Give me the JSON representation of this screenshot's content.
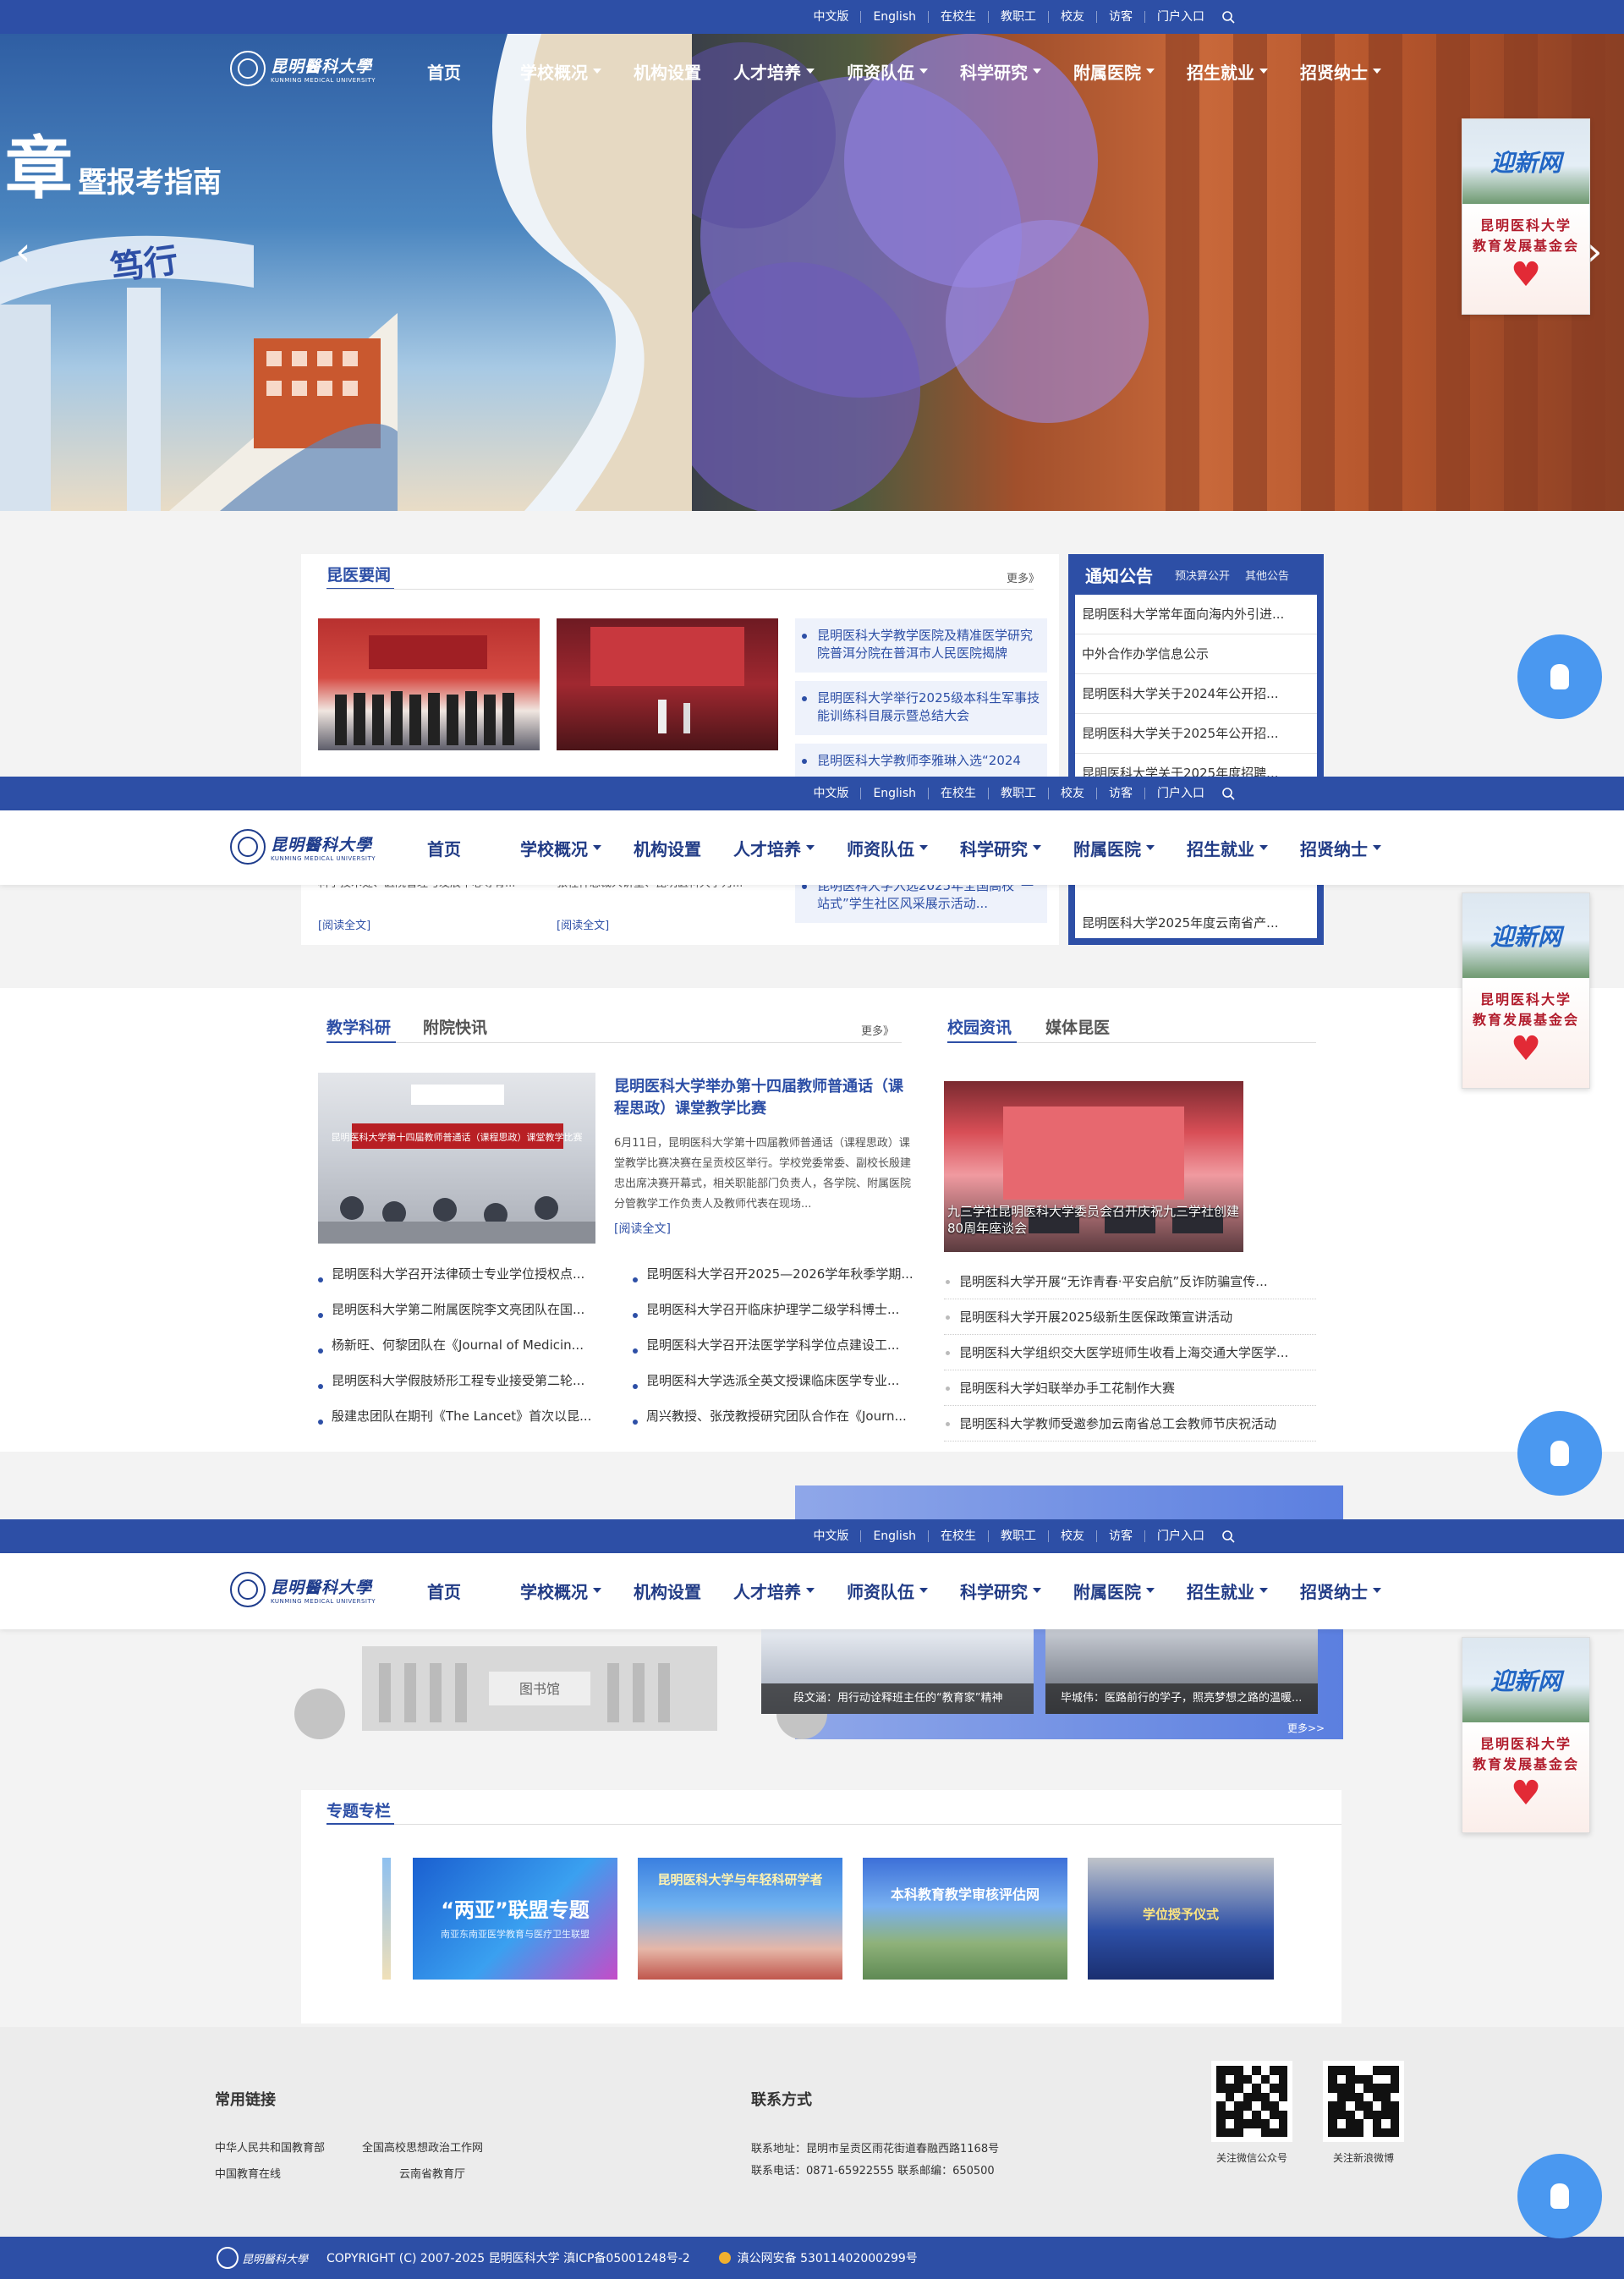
{
  "utility": {
    "items": [
      "中文版",
      "English",
      "在校生",
      "教职工",
      "校友",
      "访客",
      "门户入口"
    ]
  },
  "logo": {
    "cn": "昆明醫科大學",
    "en": "KUNMING MEDICAL UNIVERSITY"
  },
  "nav": {
    "items": [
      "首页",
      "学校概况",
      "机构设置",
      "人才培养",
      "师资队伍",
      "科学研究",
      "附属医院",
      "招生就业",
      "招贤纳士"
    ]
  },
  "hero": {
    "title_big": "章",
    "title_rest": "暨报考指南",
    "gate_text": "笃行"
  },
  "side_widget": {
    "top": "迎新网",
    "bottom_line1": "昆明医科大学",
    "bottom_line2": "教育发展基金会"
  },
  "news": {
    "title": "昆医要闻",
    "more": "更多》",
    "read_more": "[阅读全文]",
    "card1_excerpt": "科学技术处、医院管理与发展中心等有...",
    "card2_excerpt": "张程祥总裁人讲堂、昆明医科大学为...",
    "list": [
      "昆明医科大学教学医院及精准医学研究院普洱分院在普洱市人民医院揭牌",
      "昆明医科大学举行2025级本科生军事技能训练科目展示暨总结大会",
      "昆明医科大学教师李雅琳入选“2024",
      "昆明医科大学入选2025年全国高校“一站式”学生社区风采展示活动..."
    ]
  },
  "notice": {
    "title": "通知公告",
    "tab2": "预决算公开",
    "tab3": "其他公告",
    "items": [
      "昆明医科大学常年面向海内外引进...",
      "中外合作办学信息公示",
      "昆明医科大学关于2024年公开招...",
      "昆明医科大学关于2025年公开招...",
      "昆明医科大学关于2025年度招聘...",
      "昆明医科大学2025年度云南省产..."
    ]
  },
  "teaching": {
    "tab1": "教学科研",
    "tab2": "附院快讯",
    "more": "更多》",
    "feature_title": "昆明医科大学举办第十四届教师普通话（课程思政）课堂教学比赛",
    "feature_excerpt": "6月11日，昆明医科大学第十四届教师普通话（课程思政）课堂教学比赛决赛在呈贡校区举行。学校党委常委、副校长殷建忠出席决赛开幕式，相关职能部门负责人，各学院、附属医院分管教学工作负责人及教师代表在现场...",
    "read_more": "[阅读全文]",
    "img_caption": "昆明医科大学第十四届教师普通话（课程思政）课堂教学比赛",
    "left_list": [
      "昆明医科大学召开法律硕士专业学位授权点...",
      "昆明医科大学第二附属医院李文亮团队在国...",
      "杨新旺、何黎团队在《Journal of Medicin...",
      "昆明医科大学假肢矫形工程专业接受第二轮...",
      "殷建忠团队在期刊《The Lancet》首次以昆..."
    ],
    "right_list": [
      "昆明医科大学召开2025—2026学年秋季学期...",
      "昆明医科大学召开临床护理学二级学科博士...",
      "昆明医科大学召开法医学学科学位点建设工...",
      "昆明医科大学选派全英文授课临床医学专业...",
      "周兴教授、张茂教授研究团队合作在《Journ..."
    ]
  },
  "campus": {
    "tab1": "校园资讯",
    "tab2": "媒体昆医",
    "img_caption": "九三学社昆明医科大学委员会召开庆祝九三学社创建80周年座谈会",
    "list": [
      "昆明医科大学开展“无诈青春·平安启航”反诈防骗宣传...",
      "昆明医科大学开展2025级新生医保政策宣讲活动",
      "昆明医科大学组织交大医学班师生收看上海交通大学医学...",
      "昆明医科大学妇联举办手工花制作大赛",
      "昆明医科大学教师受邀参加云南省总工会教师节庆祝活动"
    ]
  },
  "people": {
    "cap1": "段文涵：用行动诠释班主任的“教育家”精神",
    "cap2": "毕城伟：医路前行的学子，照亮梦想之路的温暖...",
    "more": "更多>>",
    "library_text": "图书馆"
  },
  "topics": {
    "title": "专题专栏",
    "t1_main": "“两亚”联盟专题",
    "t1_sub": "南亚东南亚医学教育与医疗卫生联盟",
    "t2": "昆明医科大学与年轻科研学者",
    "t3": "本科教育教学审核评估网",
    "t4": "学位授予仪式"
  },
  "footer": {
    "links_title": "常用链接",
    "links": [
      "中华人民共和国教育部",
      "全国高校思想政治工作网",
      "中国教育在线",
      "云南省教育厅"
    ],
    "contact_title": "联系方式",
    "address": "联系地址：昆明市呈贡区雨花街道春融西路1168号",
    "phone": "联系电话：0871-65922555  联系邮编：650500",
    "qr1": "关注微信公众号",
    "qr2": "关注新浪微博",
    "copyright": "COPYRIGHT (C) 2007-2025  昆明医科大学  滇ICP备05001248号-2",
    "police": "滇公网安备 53011402000299号"
  },
  "colors": {
    "brand": "#2d4fa6",
    "fab": "#4a98f0",
    "nav_text": "#223c86"
  }
}
